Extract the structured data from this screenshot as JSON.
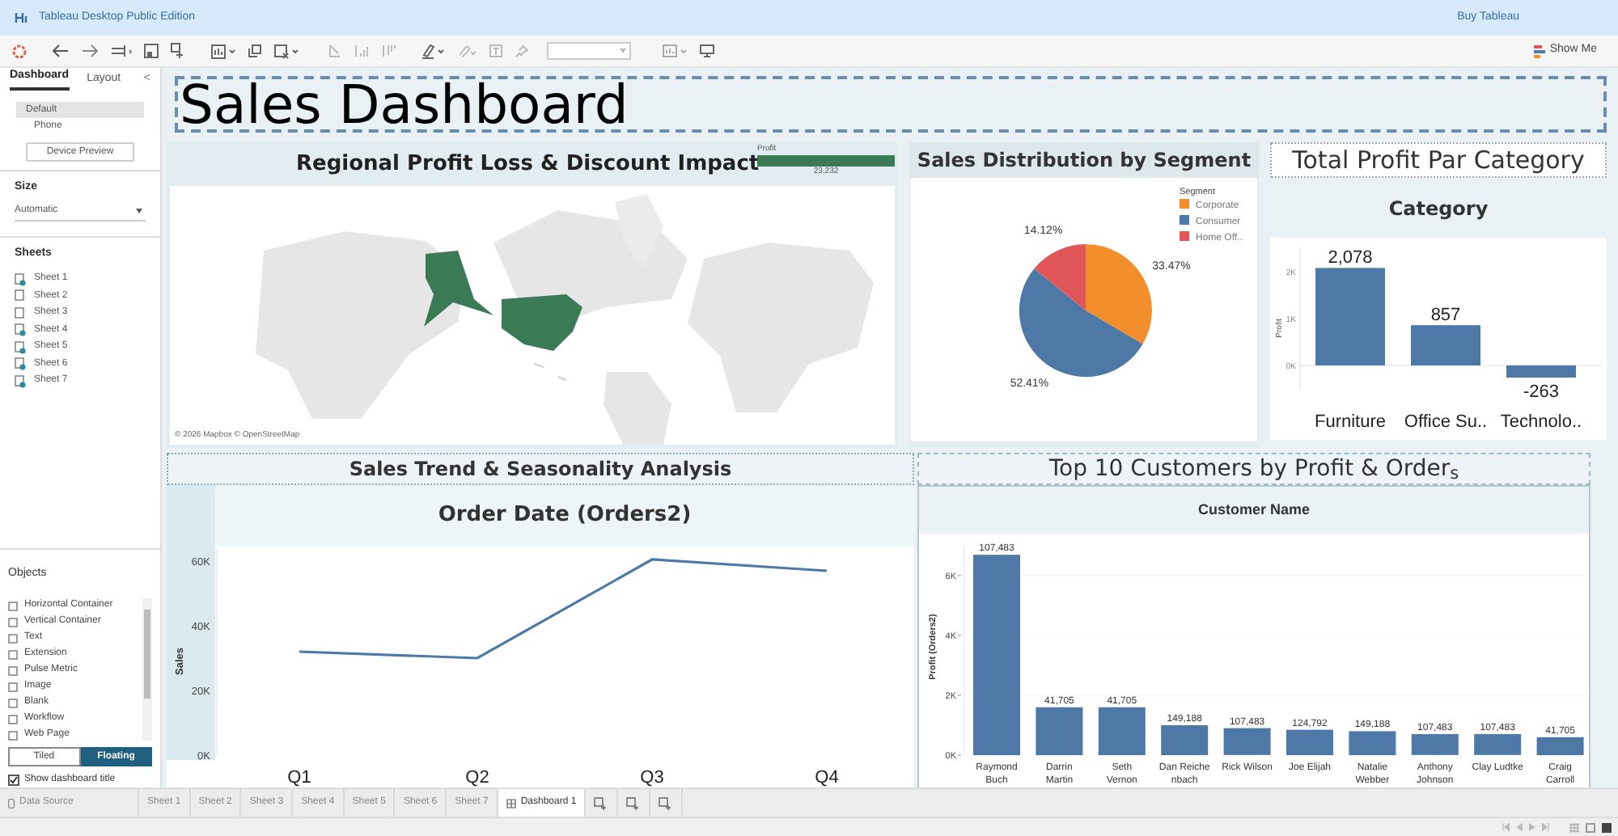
{
  "window": {
    "title": "Tableau Desktop Public Edition",
    "link": "Buy Tableau"
  },
  "toolbar": {
    "show_me": "Show Me"
  },
  "side_panel": {
    "tabs": [
      {
        "label": "Dashboard",
        "selected": true
      },
      {
        "label": "Layout",
        "selected": false
      }
    ],
    "collapse": "<",
    "devices": [
      {
        "label": "Default",
        "selected": true
      },
      {
        "label": "Phone",
        "selected": false
      }
    ],
    "device_preview": "Device Preview",
    "size": {
      "heading": "Size",
      "value": "Automatic"
    },
    "sheets": {
      "heading": "Sheets",
      "items": [
        {
          "label": "Sheet 1",
          "used": true
        },
        {
          "label": "Sheet 2",
          "used": false
        },
        {
          "label": "Sheet 3",
          "used": false
        },
        {
          "label": "Sheet 4",
          "used": true
        },
        {
          "label": "Sheet 5",
          "used": true
        },
        {
          "label": "Sheet 6",
          "used": true
        },
        {
          "label": "Sheet 7",
          "used": true
        }
      ]
    },
    "objects": {
      "heading": "Objects",
      "items": [
        "Horizontal Container",
        "Vertical Container",
        "Text",
        "Extension",
        "Pulse Metric",
        "Image",
        "Blank",
        "Workflow",
        "Web Page"
      ]
    },
    "layout_mode": [
      {
        "label": "Tiled",
        "selected": false
      },
      {
        "label": "Floating",
        "selected": true
      }
    ],
    "show_title": {
      "label": "Show dashboard title",
      "checked": true
    }
  },
  "dashboard": {
    "title": "Sales Dashboard",
    "map": {
      "title": "Regional Profit Loss & Discount Impact",
      "legend": {
        "title": "Profit",
        "value": "23,232"
      },
      "attribution": "© 2026 Mapbox © OpenStreetMap"
    },
    "segment": {
      "title": "Sales Distribution by Segment",
      "chart_data": {
        "type": "pie",
        "categories": [
          "Corporate",
          "Consumer",
          "Home Off.."
        ],
        "values": [
          33.47,
          52.41,
          14.12
        ],
        "colors": [
          "#f28e2b",
          "#4e79a7",
          "#e15759"
        ],
        "legend": {
          "title": "Segment"
        },
        "value_labels": [
          "33.47%",
          "52.41%",
          "14.12%"
        ]
      }
    },
    "category": {
      "title": "Total Profit Par Category",
      "chart_data": {
        "type": "bar",
        "title": "Category",
        "ylabel": "Profit",
        "categories": [
          "Furniture",
          "Office Su..",
          "Technolo.."
        ],
        "series": [
          {
            "color": "#4e79a7",
            "values": [
              2080,
              860,
              -260
            ]
          }
        ],
        "ylim": [
          -500,
          2500
        ],
        "yticks": [
          {
            "value": 0,
            "label": "0K"
          },
          {
            "value": 1000,
            "label": "1K"
          },
          {
            "value": 2000,
            "label": "2K"
          }
        ],
        "value_labels": [
          "2,078",
          "857",
          "-263"
        ]
      }
    },
    "trend": {
      "title": "Sales Trend & Seasonality Analysis",
      "chart_data": {
        "type": "line",
        "title": "Order Date (Orders2)",
        "ylabel": "Sales",
        "categories": [
          "Q1",
          "Q2",
          "Q3",
          "Q4"
        ],
        "series": [
          {
            "color": "#4e79a7",
            "values": [
              32000,
              30000,
              60500,
              57000
            ]
          }
        ],
        "ylim": [
          0,
          64000
        ],
        "yticks": [
          {
            "value": 0,
            "label": "0K"
          },
          {
            "value": 20000,
            "label": "20K"
          },
          {
            "value": 40000,
            "label": "40K"
          },
          {
            "value": 60000,
            "label": "60K"
          }
        ]
      }
    },
    "customers": {
      "title": "Top 10 Customers by Profit & Order$_{s}$",
      "chart_data": {
        "type": "bar",
        "title": "Customer Name",
        "ylabel": "Profit (Orders2)",
        "categories": [
          "Raymond\nBuch",
          "Darrin\nMartin",
          "Seth\nVernon",
          "Dan Reiche\nnbach",
          "Rick Wilson",
          "Joe Elijah",
          "Natalie\nWebber",
          "Anthony\nJohnson",
          "Clay Ludtke",
          "Craig\nCarroll"
        ],
        "series": [
          {
            "color": "#4e79a7",
            "values": [
              6700,
              1600,
              1600,
              1000,
              900,
              850,
              800,
              700,
              700,
              600
            ]
          }
        ],
        "ylim": [
          0,
          7000
        ],
        "grid": true,
        "yticks": [
          {
            "value": 0,
            "label": "0K"
          },
          {
            "value": 2000,
            "label": "2K"
          },
          {
            "value": 4000,
            "label": "4K"
          },
          {
            "value": 6000,
            "label": "6K"
          }
        ],
        "value_labels": [
          "107,483",
          "41,705",
          "41,705",
          "149,188",
          "107,483",
          "124,792",
          "149,188",
          "107,483",
          "107,483",
          "41,705"
        ]
      }
    }
  },
  "sheet_tabs": [
    {
      "label": "Data Source",
      "kind": "source",
      "selected": false
    },
    {
      "label": "Sheet 1",
      "kind": "sheet",
      "selected": false
    },
    {
      "label": "Sheet 2",
      "kind": "sheet",
      "selected": false
    },
    {
      "label": "Sheet 3",
      "kind": "sheet",
      "selected": false
    },
    {
      "label": "Sheet 4",
      "kind": "sheet",
      "selected": false
    },
    {
      "label": "Sheet 5",
      "kind": "sheet",
      "selected": false
    },
    {
      "label": "Sheet 6",
      "kind": "sheet",
      "selected": false
    },
    {
      "label": "Sheet 7",
      "kind": "sheet",
      "selected": false
    },
    {
      "label": "Dashboard 1",
      "kind": "dashboard",
      "selected": true
    }
  ]
}
